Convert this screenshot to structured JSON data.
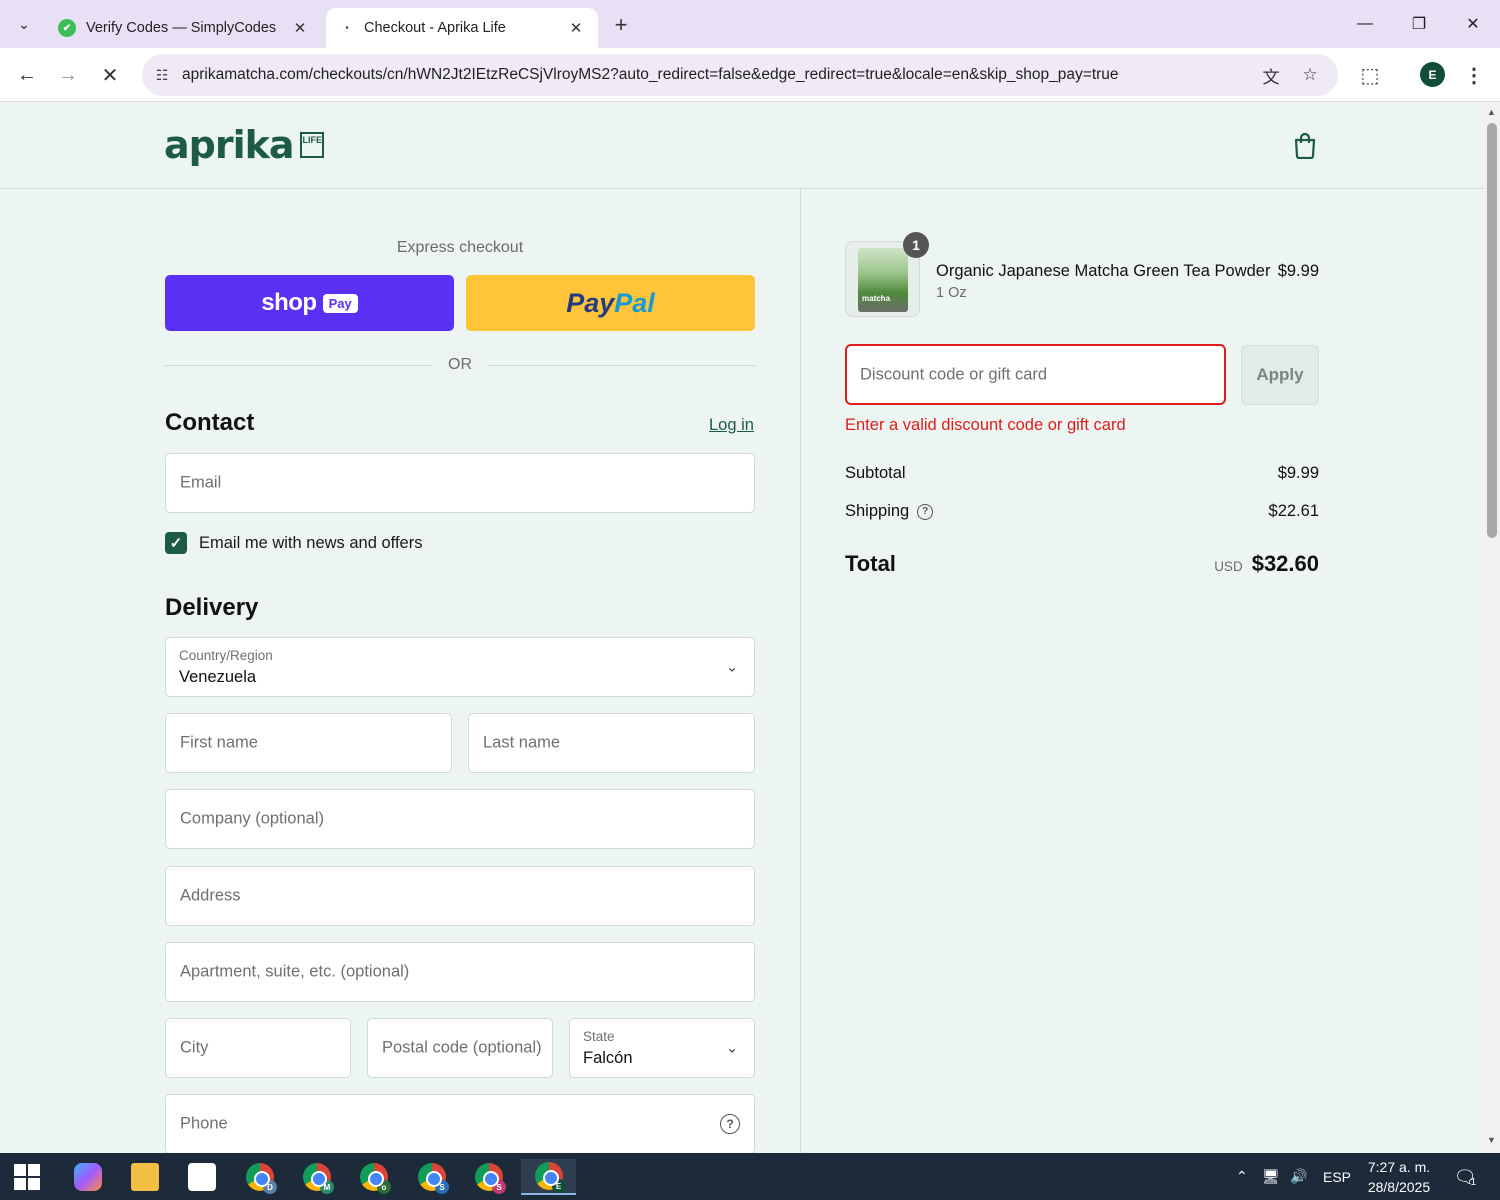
{
  "browser": {
    "tabs": [
      {
        "title": "Verify Codes — SimplyCodes",
        "active": false
      },
      {
        "title": "Checkout - Aprika Life",
        "active": true
      }
    ],
    "url": "aprikamatcha.com/checkouts/cn/hWN2Jt2IEtzReCSjVlroyMS2?auto_redirect=false&edge_redirect=true&locale=en&skip_shop_pay=true",
    "profile_initial": "E"
  },
  "header": {
    "logo_word": "aprika",
    "logo_box": "LIFE"
  },
  "express": {
    "label": "Express checkout",
    "shoppay_word": "shop",
    "shoppay_pay": "Pay",
    "paypal_pay": "Pay",
    "paypal_pal": "Pal",
    "or_text": "OR"
  },
  "contact": {
    "title": "Contact",
    "login_link": "Log in",
    "email_placeholder": "Email",
    "newsletter_label": "Email me with news and offers",
    "newsletter_checked": true
  },
  "delivery": {
    "title": "Delivery",
    "country_label": "Country/Region",
    "country_value": "Venezuela",
    "first_name_placeholder": "First name",
    "last_name_placeholder": "Last name",
    "company_placeholder": "Company (optional)",
    "address_placeholder": "Address",
    "apartment_placeholder": "Apartment, suite, etc. (optional)",
    "city_placeholder": "City",
    "postal_placeholder": "Postal code (optional)",
    "state_label": "State",
    "state_value": "Falcón",
    "phone_placeholder": "Phone"
  },
  "order": {
    "product": {
      "name": "Organic Japanese Matcha Green Tea Powder",
      "variant": "1 Oz",
      "price": "$9.99",
      "quantity": "1",
      "package_label": "matcha"
    },
    "discount_placeholder": "Discount code or gift card",
    "apply_label": "Apply",
    "discount_error": "Enter a valid discount code or gift card",
    "subtotal_label": "Subtotal",
    "subtotal_value": "$9.99",
    "shipping_label": "Shipping",
    "shipping_value": "$22.61",
    "total_label": "Total",
    "currency": "USD",
    "total_value": "$32.60"
  },
  "taskbar": {
    "apps": [
      {
        "name": "copilot",
        "badge": ""
      },
      {
        "name": "file-explorer",
        "badge": ""
      },
      {
        "name": "store",
        "badge": ""
      },
      {
        "name": "chrome",
        "badge": "D",
        "badge_color": "#5b7fa6"
      },
      {
        "name": "chrome",
        "badge": "M",
        "badge_color": "#2a8a6a"
      },
      {
        "name": "chrome",
        "badge": "o",
        "badge_color": "#2e6b3a"
      },
      {
        "name": "chrome",
        "badge": "S",
        "badge_color": "#2a6fb5"
      },
      {
        "name": "chrome",
        "badge": "S",
        "badge_color": "#c23a6b"
      },
      {
        "name": "chrome",
        "badge": "E",
        "badge_color": "#124d3c"
      }
    ],
    "language": "ESP",
    "time": "7:27 a. m.",
    "date": "28/8/2025",
    "notification_count": "1"
  }
}
